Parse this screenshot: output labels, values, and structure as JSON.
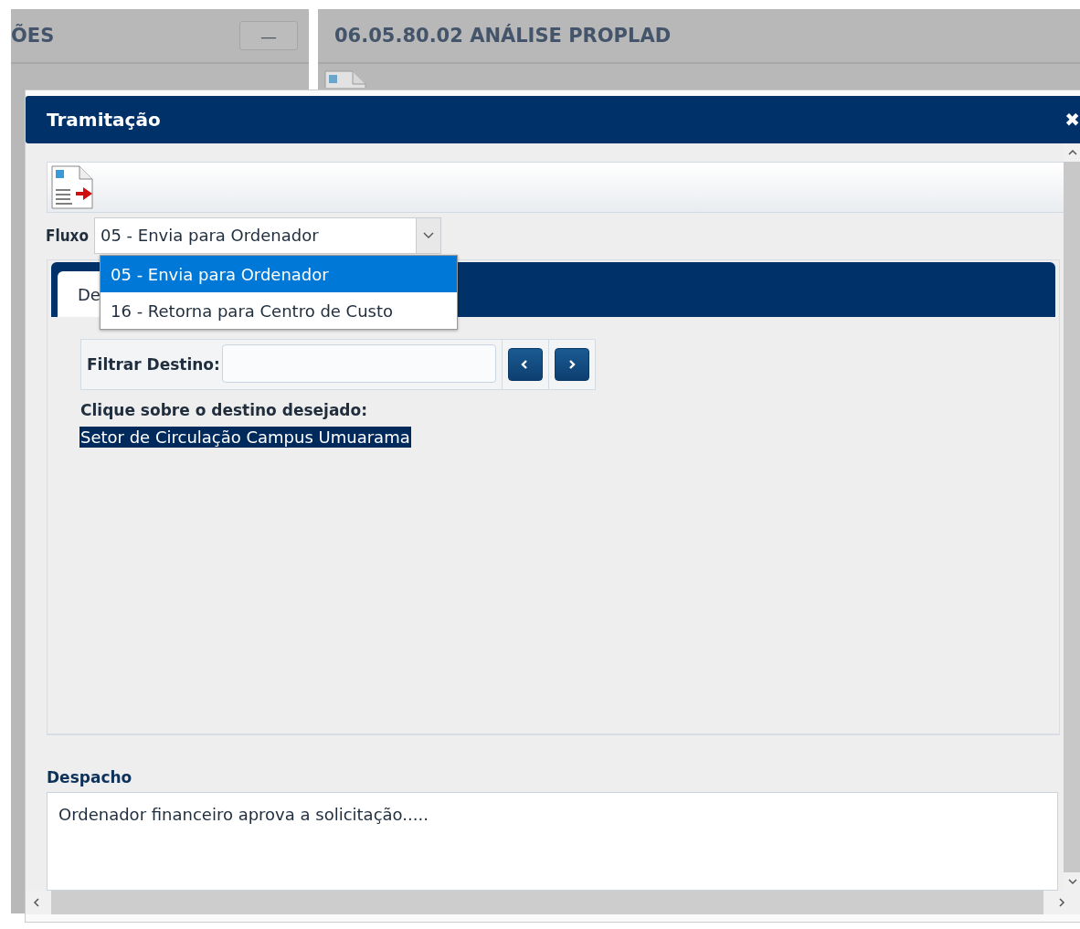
{
  "background": {
    "left_panel": {
      "title": "ÕES",
      "button": "—"
    },
    "right_panel": {
      "title": "06.05.80.02 ANÁLISE PROPLAD"
    }
  },
  "dialog": {
    "title": "Tramitação",
    "close": "✖",
    "fluxo": {
      "label": "Fluxo",
      "value": "05 - Envia para Ordenador",
      "expanded": true,
      "options": [
        {
          "label": "05 - Envia para Ordenador",
          "selected": true
        },
        {
          "label": "16 - Retorna para Centro de Custo",
          "selected": false
        }
      ]
    },
    "tabs": [
      {
        "label": "De",
        "selected": true
      }
    ],
    "filter": {
      "label": "Filtrar Destino:"
    },
    "instruction": "Clique sobre o destino desejado:",
    "destinations": [
      {
        "label": "Setor de Circulação Campus Umuarama",
        "selected": true
      }
    ],
    "despacho": {
      "label": "Despacho",
      "value": "Ordenador financeiro aprova a solicitação....."
    }
  }
}
